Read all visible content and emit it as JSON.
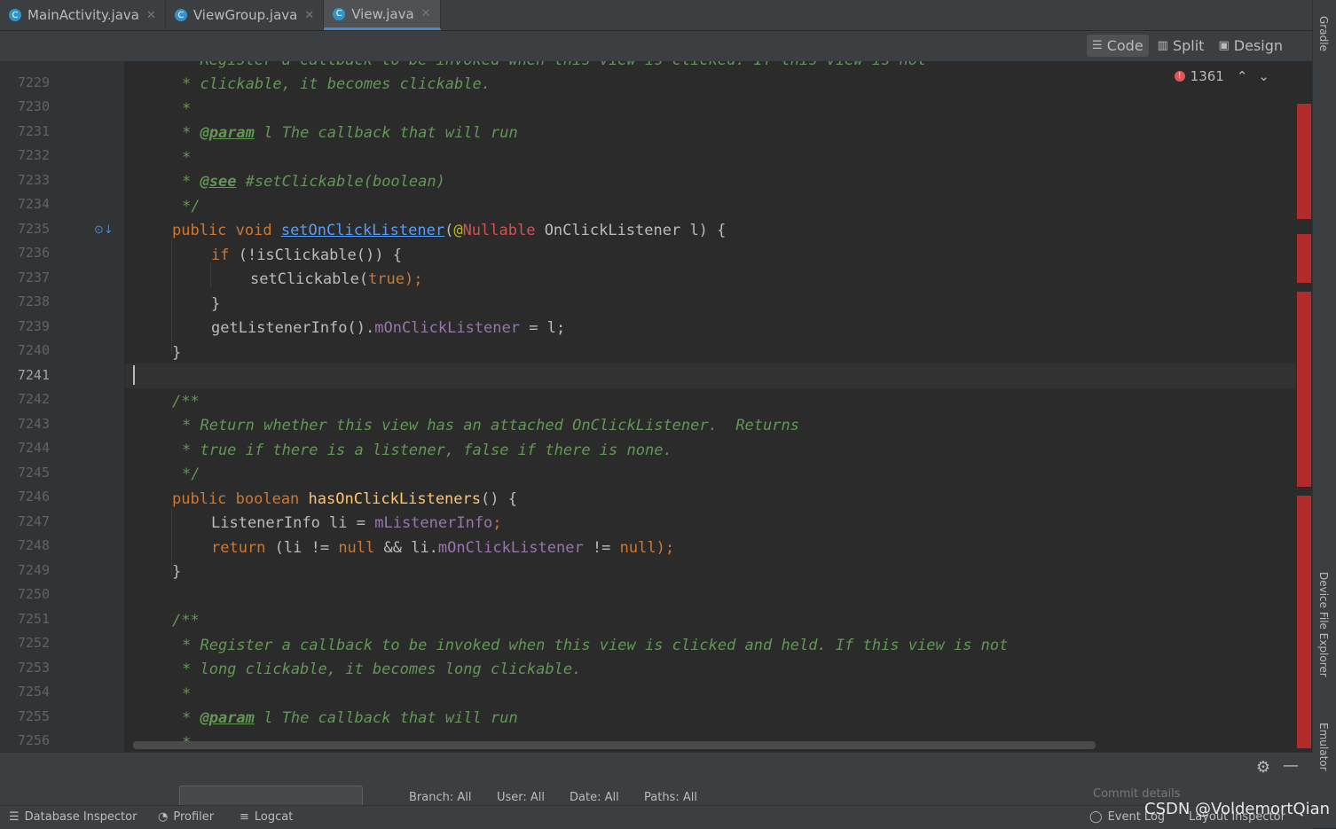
{
  "tabs": [
    {
      "label": "MainActivity.java",
      "icon": "c"
    },
    {
      "label": "ViewGroup.java",
      "icon": "c"
    },
    {
      "label": "View.java",
      "icon": "c"
    }
  ],
  "view_modes": {
    "code": "Code",
    "split": "Split",
    "design": "Design"
  },
  "problems": {
    "count": "1361"
  },
  "line_numbers": [
    "7229",
    "7230",
    "7231",
    "7232",
    "7233",
    "7234",
    "7235",
    "7236",
    "7237",
    "7238",
    "7239",
    "7240",
    "7241",
    "7242",
    "7243",
    "7244",
    "7245",
    "7246",
    "7247",
    "7248",
    "7249",
    "7250",
    "7251",
    "7252",
    "7253",
    "7254",
    "7255",
    "7256"
  ],
  "code": {
    "l7228": "* Register a callback to be invoked when this view is clicked. If this view is not",
    "l7229": "* clickable, it becomes clickable.",
    "l7230": "*",
    "l7231_a": "* ",
    "l7231_tag": "@param",
    "l7231_b": " l The callback that will run",
    "l7232": "*",
    "l7233_a": "* ",
    "l7233_tag": "@see",
    "l7233_b": " #setClickable(boolean)",
    "l7234": "*/",
    "l7235_kw": "public void ",
    "l7235_fn": "setOnClickListener",
    "l7235_p": "(",
    "l7235_ann": "@",
    "l7235_ann2": "Nullable",
    "l7235_rest": " OnClickListener l) {",
    "l7236_kw": "if ",
    "l7236_rest": "(!isClickable()) {",
    "l7237_a": "setClickable(",
    "l7237_kw": "true",
    "l7237_b": ");",
    "l7238": "}",
    "l7239_a": "getListenerInfo().",
    "l7239_fld": "mOnClickListener",
    "l7239_b": " = l;",
    "l7240": "}",
    "l7242": "/**",
    "l7243": "* Return whether this view has an attached OnClickListener.  Returns",
    "l7244": "* true if there is a listener, false if there is none.",
    "l7245": "*/",
    "l7246_kw": "public boolean ",
    "l7246_fn": "hasOnClickListeners",
    "l7246_rest": "() {",
    "l7247_a": "ListenerInfo li = ",
    "l7247_fld": "mListenerInfo",
    "l7247_b": ";",
    "l7248_kw": "return ",
    "l7248_a": "(li != ",
    "l7248_kw2": "null",
    "l7248_b": " && li.",
    "l7248_fld": "mOnClickListener",
    "l7248_c": " != ",
    "l7248_kw3": "null",
    "l7248_d": ");",
    "l7249": "}",
    "l7251": "/**",
    "l7252": "* Register a callback to be invoked when this view is clicked and held. If this view is not",
    "l7253": "* long clickable, it becomes long clickable.",
    "l7254": "*",
    "l7255_a": "* ",
    "l7255_tag": "@param",
    "l7255_b": " l The callback that will run",
    "l7256": "*"
  },
  "right_tools": {
    "gradle": "Gradle",
    "device_file_explorer": "Device File Explorer",
    "emulator": "Emulator"
  },
  "git_filters": {
    "branch": "Branch: All",
    "user": "User: All",
    "date": "Date: All",
    "paths": "Paths: All",
    "commit_details": "Commit details"
  },
  "status_items": {
    "database_inspector": "Database Inspector",
    "profiler": "Profiler",
    "logcat": "Logcat",
    "event_log": "Event Log",
    "layout_inspector": "Layout Inspector"
  },
  "watermark": "CSDN @VoldemortQian",
  "colors": {
    "keyword": "#cc7832",
    "doc": "#629755",
    "field": "#9876aa",
    "method": "#ffc66d",
    "link": "#589df6",
    "error": "#b22b2b"
  }
}
